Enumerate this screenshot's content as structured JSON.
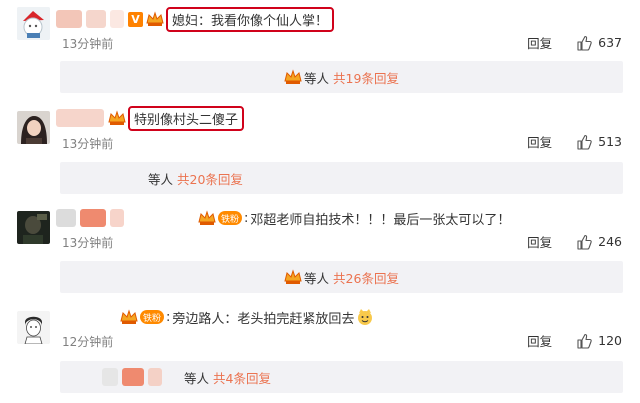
{
  "comments": [
    {
      "text": "媳妇：我看你像个仙人掌！",
      "time": "13分钟前",
      "reply": "回复",
      "likes": "637",
      "replies_who": "等人",
      "replies_count": "共19条回复"
    },
    {
      "text": "特别像村头二傻子",
      "time": "13分钟前",
      "reply": "回复",
      "likes": "513",
      "replies_who": "等人",
      "replies_count": "共20条回复"
    },
    {
      "badge": "铁粉",
      "text": "邓超老师自拍技术！！！最后一张太可以了！",
      "time": "13分钟前",
      "reply": "回复",
      "likes": "246",
      "replies_who": "等人",
      "replies_count": "共26条回复"
    },
    {
      "badge": "铁粉",
      "text": "旁边路人：老头拍完赶紧放回去",
      "time": "12分钟前",
      "reply": "回复",
      "likes": "120",
      "replies_who": "等人",
      "replies_count": "共4条回复"
    }
  ],
  "colors": {
    "highlight_border": "#d0021b",
    "link": "#eb7350",
    "reply_bg": "#f2f2f5",
    "fan_badge": "#ff8a00"
  },
  "icons": [
    "avatar",
    "v-badge",
    "crown-icon",
    "thumb-up-icon",
    "emoji-icon"
  ]
}
